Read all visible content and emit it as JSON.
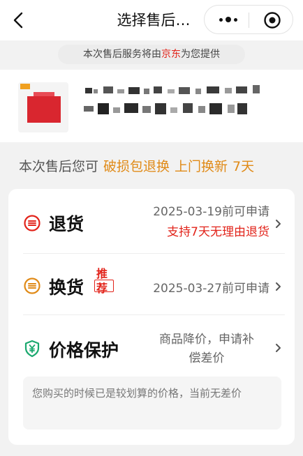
{
  "nav": {
    "title": "选择售后…",
    "back_icon": "chevron-left-icon",
    "more_icon": "more-dots-icon",
    "close_icon": "target-close-icon"
  },
  "notice": {
    "prefix": "本次售后服务将由",
    "brand": "京东",
    "suffix": "为您提供"
  },
  "product": {
    "thumbnail_icon": "product-thumbnail-icon"
  },
  "scope": {
    "lead": "本次售后您可",
    "tags": [
      "破损包退换",
      "上门换新",
      "7天"
    ]
  },
  "options": {
    "return": {
      "label": "退货",
      "deadline": "2025-03-19前可申请",
      "note": "支持7天无理由退货"
    },
    "exchange": {
      "label": "换货",
      "badge": [
        "推",
        "荐"
      ],
      "deadline": "2025-03-27前可申请"
    },
    "price_protect": {
      "label": "价格保护",
      "desc_line1": "商品降价，申请补",
      "desc_line2": "偿差价",
      "info": "您购买的时候已是较划算的价格，当前无差价"
    }
  },
  "colors": {
    "brand_red": "#e2231a",
    "accent_orange": "#e08a17",
    "icon_green": "#1aa86e"
  }
}
